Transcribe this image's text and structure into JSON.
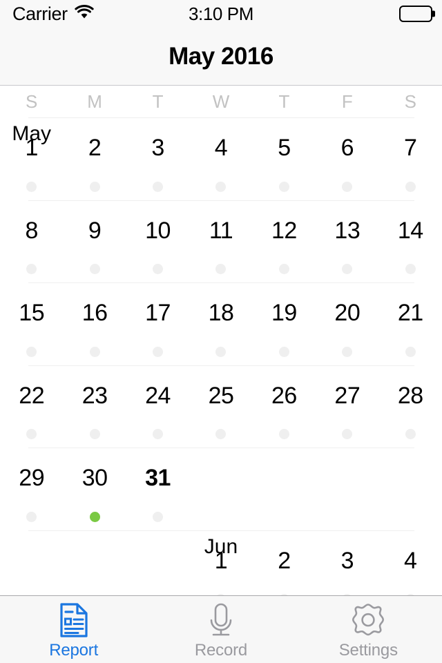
{
  "status_bar": {
    "carrier": "Carrier",
    "wifi_icon": "wifi-icon",
    "time": "3:10 PM",
    "battery_icon": "battery-full-icon",
    "battery_level": 100
  },
  "nav_bar": {
    "title": "May 2016"
  },
  "calendar": {
    "weekday_headers": [
      "S",
      "M",
      "T",
      "W",
      "T",
      "F",
      "S"
    ],
    "accent_dot_color": "#7ac943",
    "inactive_dot_color": "#efefef",
    "weeks": [
      [
        {
          "day": "1",
          "month_tag": "May",
          "dot": "inactive",
          "today": false
        },
        {
          "day": "2",
          "month_tag": "",
          "dot": "inactive",
          "today": false
        },
        {
          "day": "3",
          "month_tag": "",
          "dot": "inactive",
          "today": false
        },
        {
          "day": "4",
          "month_tag": "",
          "dot": "inactive",
          "today": false
        },
        {
          "day": "5",
          "month_tag": "",
          "dot": "inactive",
          "today": false
        },
        {
          "day": "6",
          "month_tag": "",
          "dot": "inactive",
          "today": false
        },
        {
          "day": "7",
          "month_tag": "",
          "dot": "inactive",
          "today": false
        }
      ],
      [
        {
          "day": "8",
          "month_tag": "",
          "dot": "inactive",
          "today": false
        },
        {
          "day": "9",
          "month_tag": "",
          "dot": "inactive",
          "today": false
        },
        {
          "day": "10",
          "month_tag": "",
          "dot": "inactive",
          "today": false
        },
        {
          "day": "11",
          "month_tag": "",
          "dot": "inactive",
          "today": false
        },
        {
          "day": "12",
          "month_tag": "",
          "dot": "inactive",
          "today": false
        },
        {
          "day": "13",
          "month_tag": "",
          "dot": "inactive",
          "today": false
        },
        {
          "day": "14",
          "month_tag": "",
          "dot": "inactive",
          "today": false
        }
      ],
      [
        {
          "day": "15",
          "month_tag": "",
          "dot": "inactive",
          "today": false
        },
        {
          "day": "16",
          "month_tag": "",
          "dot": "inactive",
          "today": false
        },
        {
          "day": "17",
          "month_tag": "",
          "dot": "inactive",
          "today": false
        },
        {
          "day": "18",
          "month_tag": "",
          "dot": "inactive",
          "today": false
        },
        {
          "day": "19",
          "month_tag": "",
          "dot": "inactive",
          "today": false
        },
        {
          "day": "20",
          "month_tag": "",
          "dot": "inactive",
          "today": false
        },
        {
          "day": "21",
          "month_tag": "",
          "dot": "inactive",
          "today": false
        }
      ],
      [
        {
          "day": "22",
          "month_tag": "",
          "dot": "inactive",
          "today": false
        },
        {
          "day": "23",
          "month_tag": "",
          "dot": "inactive",
          "today": false
        },
        {
          "day": "24",
          "month_tag": "",
          "dot": "inactive",
          "today": false
        },
        {
          "day": "25",
          "month_tag": "",
          "dot": "inactive",
          "today": false
        },
        {
          "day": "26",
          "month_tag": "",
          "dot": "inactive",
          "today": false
        },
        {
          "day": "27",
          "month_tag": "",
          "dot": "inactive",
          "today": false
        },
        {
          "day": "28",
          "month_tag": "",
          "dot": "inactive",
          "today": false
        }
      ],
      [
        {
          "day": "29",
          "month_tag": "",
          "dot": "inactive",
          "today": false
        },
        {
          "day": "30",
          "month_tag": "",
          "dot": "active",
          "today": false
        },
        {
          "day": "31",
          "month_tag": "",
          "dot": "inactive",
          "today": true
        },
        {
          "day": "",
          "month_tag": "",
          "dot": "none",
          "today": false
        },
        {
          "day": "",
          "month_tag": "",
          "dot": "none",
          "today": false
        },
        {
          "day": "",
          "month_tag": "",
          "dot": "none",
          "today": false
        },
        {
          "day": "",
          "month_tag": "",
          "dot": "none",
          "today": false
        }
      ],
      [
        {
          "day": "",
          "month_tag": "",
          "dot": "none",
          "today": false
        },
        {
          "day": "",
          "month_tag": "",
          "dot": "none",
          "today": false
        },
        {
          "day": "",
          "month_tag": "",
          "dot": "none",
          "today": false
        },
        {
          "day": "1",
          "month_tag": "Jun",
          "dot": "inactive",
          "today": false
        },
        {
          "day": "2",
          "month_tag": "",
          "dot": "inactive",
          "today": false
        },
        {
          "day": "3",
          "month_tag": "",
          "dot": "inactive",
          "today": false
        },
        {
          "day": "4",
          "month_tag": "",
          "dot": "inactive",
          "today": false
        }
      ]
    ]
  },
  "tab_bar": {
    "active_color": "#1b76e0",
    "inactive_color": "#9a9a9f",
    "tabs": [
      {
        "label": "Report",
        "icon": "document-report-icon",
        "active": true
      },
      {
        "label": "Record",
        "icon": "microphone-icon",
        "active": false
      },
      {
        "label": "Settings",
        "icon": "gear-icon",
        "active": false
      }
    ]
  }
}
